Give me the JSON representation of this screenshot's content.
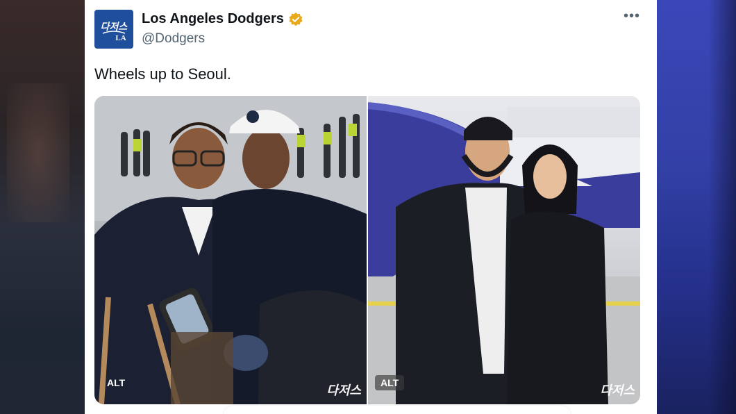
{
  "tweet": {
    "display_name": "Los Angeles Dodgers",
    "handle": "@Dodgers",
    "text": "Wheels up to Seoul.",
    "more_label": "•••",
    "avatar_icon": "dodgers-logo-icon",
    "verified_icon": "verified-badge-icon",
    "verified_color": "#e8a91c",
    "brand_color": "#1f4e9c"
  },
  "media": {
    "photos": [
      {
        "alt_label": "ALT",
        "watermark": "다저스"
      },
      {
        "alt_label": "ALT",
        "watermark": "다저스"
      }
    ]
  }
}
